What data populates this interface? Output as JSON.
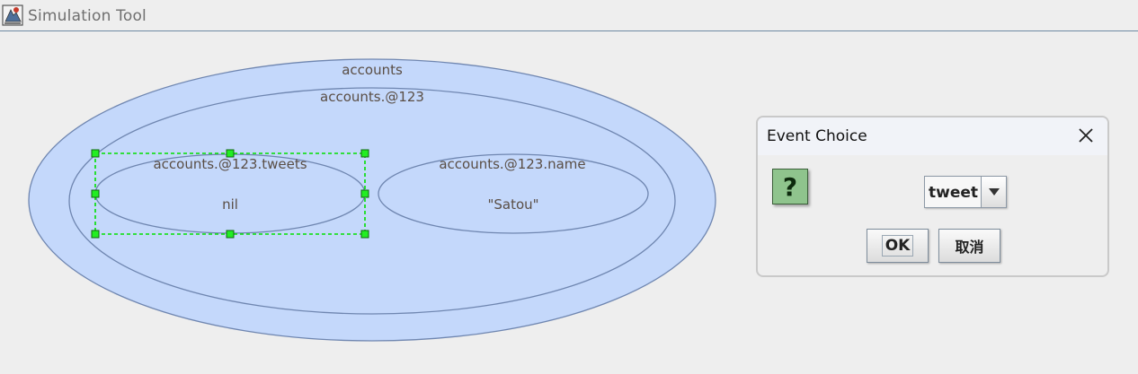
{
  "window": {
    "title": "Simulation Tool",
    "icon": "java-app-icon"
  },
  "canvas": {
    "background": "#eeeeee",
    "ellipse_fill": "#c4d8fb",
    "ellipse_stroke": "#6f86b0",
    "selection_color": "#00e000",
    "entities": [
      {
        "name": "accounts",
        "label": "accounts"
      },
      {
        "name": "accounts-123",
        "label": "accounts.@123"
      },
      {
        "name": "tweets",
        "label": "accounts.@123.tweets",
        "value": "nil",
        "selected": true
      },
      {
        "name": "name",
        "label": "accounts.@123.name",
        "value": "\"Satou\""
      }
    ]
  },
  "dialog": {
    "title": "Event Choice",
    "help_icon": "question-mark-icon",
    "close_icon": "close-icon",
    "combo": {
      "value": "tweet",
      "arrow_icon": "triangle-down-icon"
    },
    "ok_label": "OK",
    "cancel_label": "取消"
  }
}
